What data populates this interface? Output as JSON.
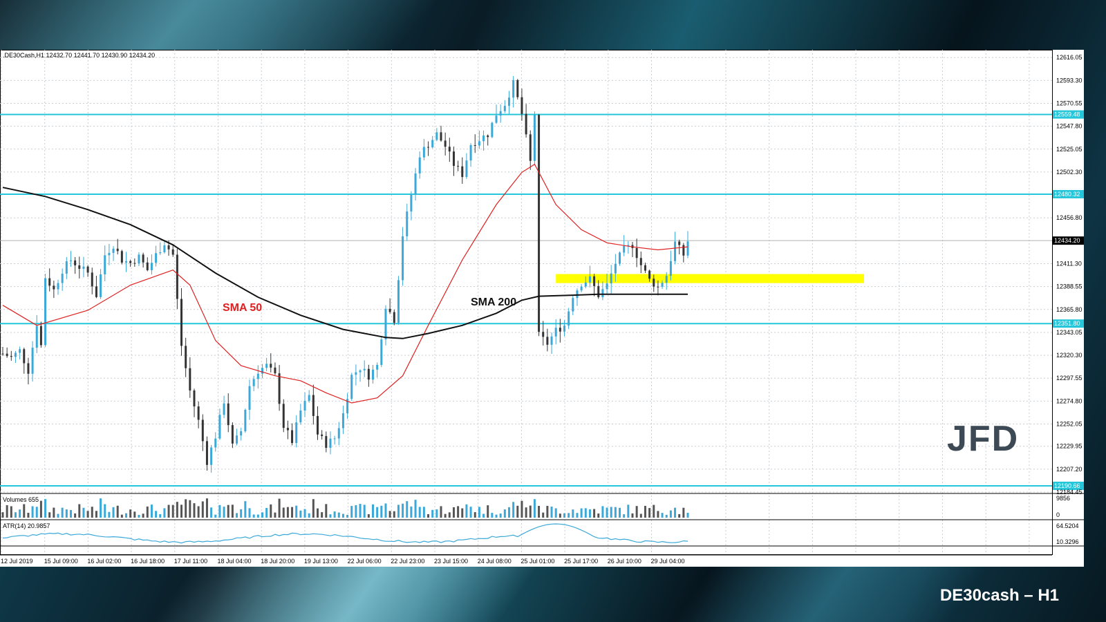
{
  "caption": "DE30cash – H1",
  "logo_text": "JFD",
  "chart_data": {
    "type": "candlestick",
    "symbol_header": ".DE30Cash,H1  12432.70 12441.70 12430.90 12434.20",
    "price_axis": {
      "ticks": [
        "12616.05",
        "12593.30",
        "12570.55",
        "12547.80",
        "12525.05",
        "12502.30",
        "12456.80",
        "12411.30",
        "12388.55",
        "12365.80",
        "12343.05",
        "12320.30",
        "12297.55",
        "12274.80",
        "12252.05",
        "12229.95",
        "12207.20",
        "12184.45"
      ],
      "tick_values": [
        12616.05,
        12593.3,
        12570.55,
        12547.8,
        12525.05,
        12502.3,
        12456.8,
        12411.3,
        12388.55,
        12365.8,
        12343.05,
        12320.3,
        12297.55,
        12274.8,
        12252.05,
        12229.95,
        12207.2,
        12184.45
      ],
      "range": [
        12184.45,
        12621.0
      ]
    },
    "horizontal_levels": [
      {
        "value": 12559.48,
        "label": "12559.48",
        "color": "#26c6da"
      },
      {
        "value": 12480.32,
        "label": "12480.32",
        "color": "#26c6da"
      },
      {
        "value": 12351.8,
        "label": "12351.80",
        "color": "#26c6da"
      },
      {
        "value": 12190.66,
        "label": "12190.66",
        "color": "#26c6da"
      }
    ],
    "current_price": {
      "value": 12434.2,
      "label": "12434.20"
    },
    "highlight_zone": {
      "from": 12392,
      "to": 12401,
      "color": "#ffff00"
    },
    "time_axis": [
      "12 Jul 2019",
      "15 Jul 09:00",
      "16 Jul 02:00",
      "16 Jul 18:00",
      "17 Jul 11:00",
      "18 Jul 04:00",
      "18 Jul 20:00",
      "19 Jul 13:00",
      "22 Jul 06:00",
      "22 Jul 23:00",
      "23 Jul 15:00",
      "24 Jul 08:00",
      "25 Jul 01:00",
      "25 Jul 17:00",
      "26 Jul 10:00",
      "29 Jul 04:00"
    ],
    "price_path": [
      [
        0,
        12322
      ],
      [
        2,
        12318
      ],
      [
        4,
        12325
      ],
      [
        6,
        12305
      ],
      [
        8,
        12352
      ],
      [
        9,
        12330
      ],
      [
        10,
        12398
      ],
      [
        12,
        12385
      ],
      [
        14,
        12405
      ],
      [
        16,
        12415
      ],
      [
        18,
        12408
      ],
      [
        20,
        12402
      ],
      [
        22,
        12380
      ],
      [
        24,
        12420
      ],
      [
        26,
        12430
      ],
      [
        28,
        12415
      ],
      [
        30,
        12412
      ],
      [
        32,
        12418
      ],
      [
        34,
        12405
      ],
      [
        36,
        12420
      ],
      [
        38,
        12432
      ],
      [
        40,
        12420
      ],
      [
        42,
        12330
      ],
      [
        44,
        12285
      ],
      [
        46,
        12255
      ],
      [
        48,
        12215
      ],
      [
        50,
        12240
      ],
      [
        52,
        12275
      ],
      [
        54,
        12230
      ],
      [
        56,
        12245
      ],
      [
        58,
        12290
      ],
      [
        60,
        12305
      ],
      [
        62,
        12310
      ],
      [
        64,
        12300
      ],
      [
        66,
        12250
      ],
      [
        68,
        12235
      ],
      [
        70,
        12265
      ],
      [
        72,
        12280
      ],
      [
        74,
        12242
      ],
      [
        76,
        12232
      ],
      [
        78,
        12238
      ],
      [
        80,
        12262
      ],
      [
        82,
        12300
      ],
      [
        84,
        12308
      ],
      [
        86,
        12300
      ],
      [
        88,
        12310
      ],
      [
        90,
        12370
      ],
      [
        92,
        12356
      ],
      [
        94,
        12440
      ],
      [
        96,
        12480
      ],
      [
        98,
        12520
      ],
      [
        100,
        12530
      ],
      [
        102,
        12540
      ],
      [
        104,
        12528
      ],
      [
        106,
        12510
      ],
      [
        108,
        12500
      ],
      [
        110,
        12530
      ],
      [
        112,
        12535
      ],
      [
        114,
        12540
      ],
      [
        116,
        12560
      ],
      [
        118,
        12570
      ],
      [
        120,
        12590
      ],
      [
        122,
        12560
      ],
      [
        124,
        12512
      ],
      [
        125,
        12560
      ],
      [
        126,
        12340
      ],
      [
        128,
        12332
      ],
      [
        130,
        12345
      ],
      [
        132,
        12350
      ],
      [
        134,
        12380
      ],
      [
        136,
        12392
      ],
      [
        138,
        12396
      ],
      [
        140,
        12380
      ],
      [
        142,
        12390
      ],
      [
        144,
        12412
      ],
      [
        146,
        12425
      ],
      [
        148,
        12430
      ],
      [
        150,
        12410
      ],
      [
        152,
        12395
      ],
      [
        154,
        12388
      ],
      [
        156,
        12400
      ],
      [
        158,
        12432
      ],
      [
        160,
        12420
      ],
      [
        161,
        12434
      ]
    ],
    "sma50": {
      "name": "SMA 50",
      "color": "#e02020",
      "points": [
        [
          0,
          12370
        ],
        [
          8,
          12350
        ],
        [
          20,
          12365
        ],
        [
          30,
          12390
        ],
        [
          40,
          12405
        ],
        [
          44,
          12390
        ],
        [
          50,
          12335
        ],
        [
          56,
          12310
        ],
        [
          64,
          12300
        ],
        [
          70,
          12295
        ],
        [
          76,
          12283
        ],
        [
          82,
          12273
        ],
        [
          88,
          12278
        ],
        [
          94,
          12300
        ],
        [
          100,
          12350
        ],
        [
          108,
          12415
        ],
        [
          116,
          12470
        ],
        [
          122,
          12502
        ],
        [
          125,
          12510
        ],
        [
          130,
          12470
        ],
        [
          136,
          12445
        ],
        [
          142,
          12432
        ],
        [
          148,
          12428
        ],
        [
          154,
          12425
        ],
        [
          161,
          12428
        ]
      ]
    },
    "sma200": {
      "name": "SMA 200",
      "color": "#111111",
      "points": [
        [
          0,
          12487
        ],
        [
          10,
          12478
        ],
        [
          20,
          12465
        ],
        [
          30,
          12450
        ],
        [
          40,
          12430
        ],
        [
          50,
          12402
        ],
        [
          60,
          12378
        ],
        [
          70,
          12360
        ],
        [
          80,
          12346
        ],
        [
          90,
          12338
        ],
        [
          94,
          12337
        ],
        [
          100,
          12342
        ],
        [
          108,
          12350
        ],
        [
          116,
          12362
        ],
        [
          122,
          12375
        ],
        [
          126,
          12379
        ],
        [
          134,
          12380
        ],
        [
          140,
          12381
        ],
        [
          148,
          12381
        ],
        [
          155,
          12381
        ],
        [
          161,
          12381
        ]
      ]
    },
    "volumes_panel": {
      "label": "Volumes 655",
      "ticks": [
        "9856",
        "0"
      ]
    },
    "atr_panel": {
      "label": "ATR(14) 20.9857",
      "ticks": [
        "64.5204",
        "10.3296"
      ]
    }
  }
}
